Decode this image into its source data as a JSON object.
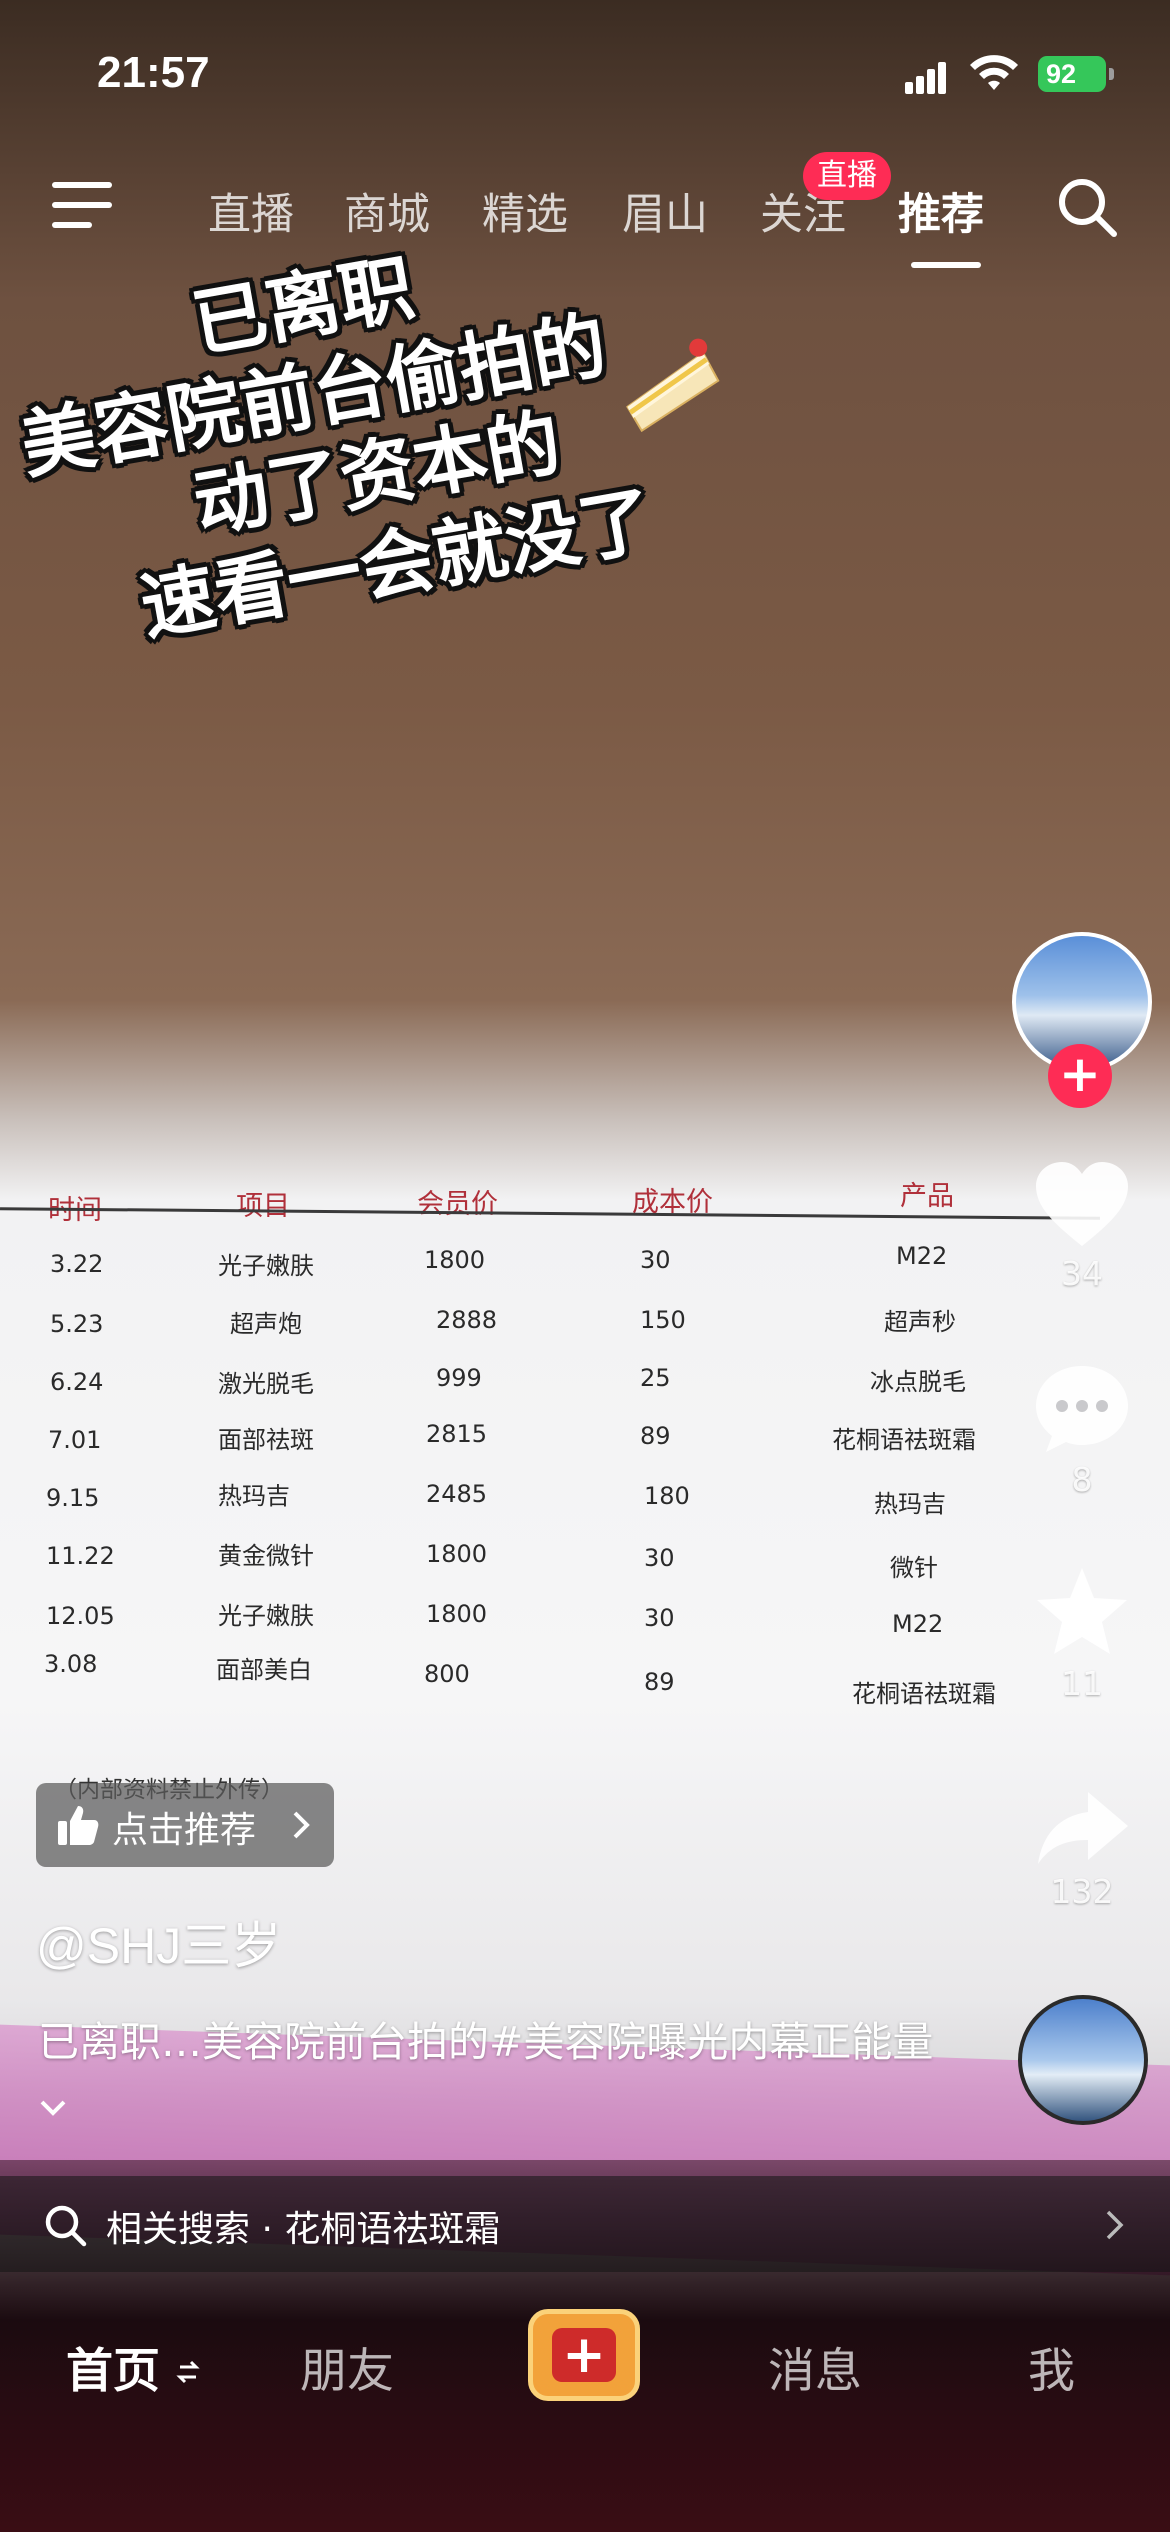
{
  "status_bar": {
    "time": "21:57",
    "battery": "92"
  },
  "top_nav": {
    "tabs": [
      {
        "label": "直播"
      },
      {
        "label": "商城"
      },
      {
        "label": "精选"
      },
      {
        "label": "眉山"
      },
      {
        "label": "关注"
      },
      {
        "label": "推荐"
      }
    ],
    "active_tab": "推荐",
    "live_badge": "直播"
  },
  "caption": {
    "lines": [
      "已离职",
      "美容院前台偷拍的",
      "动了资本的",
      "速看一会就没了"
    ]
  },
  "document": {
    "headers": [
      "时间",
      "项目",
      "会员价",
      "成本价",
      "产品"
    ],
    "rows": [
      [
        "3.22",
        "光子嫩肤",
        "1800",
        "30",
        "M22"
      ],
      [
        "5.23",
        "超声炮",
        "2888",
        "150",
        "超声秒"
      ],
      [
        "6.24",
        "激光脱毛",
        "999",
        "25",
        "冰点脱毛"
      ],
      [
        "7.01",
        "面部祛斑",
        "2815",
        "89",
        "花桐语祛斑霜"
      ],
      [
        "9.15",
        "热玛吉",
        "2485",
        "180",
        "热玛吉"
      ],
      [
        "11.22",
        "黄金微针",
        "1800",
        "30",
        "微针"
      ],
      [
        "12.05",
        "光子嫩肤",
        "1800",
        "30",
        "M22"
      ],
      [
        "3.08",
        "面部美白",
        "800",
        "89",
        "花桐语祛斑霜"
      ]
    ],
    "note": "（内部资料禁止外传）"
  },
  "actions": {
    "likes": "34",
    "comments": "8",
    "favorites": "11",
    "shares": "132"
  },
  "recommend_label": "点击推荐",
  "author": "@SHJ三岁",
  "description": "已离职…美容院前台拍的#美容院曝光内幕正能量",
  "related_search": "相关搜索 · 花桐语祛斑霜",
  "bottom_tabs": {
    "home": "首页",
    "friends": "朋友",
    "messages": "消息",
    "me": "我"
  },
  "colors": {
    "accent": "#fe2c55",
    "battery": "#35c75a",
    "create_button": "#f2a23a"
  }
}
